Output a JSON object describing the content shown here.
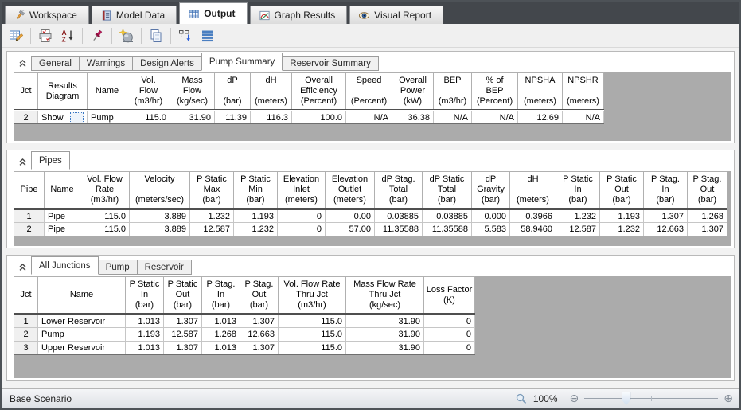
{
  "titlebar_tabs": {
    "items": [
      {
        "label": "Workspace",
        "icon": "workspace-icon"
      },
      {
        "label": "Model Data",
        "icon": "model-data-icon"
      },
      {
        "label": "Output",
        "icon": "output-icon",
        "active": true
      },
      {
        "label": "Graph Results",
        "icon": "graph-results-icon"
      },
      {
        "label": "Visual Report",
        "icon": "visual-report-icon"
      }
    ]
  },
  "toolbar": {
    "buttons": [
      "output-control",
      "print",
      "sort-az",
      "pin",
      "format-wizard",
      "copy",
      "transfer-results",
      "show-rows"
    ]
  },
  "sections": [
    {
      "id": "summary",
      "tabs": [
        "General",
        "Warnings",
        "Design Alerts",
        "Pump Summary",
        "Reservoir Summary"
      ],
      "active_tab": 3,
      "table": {
        "headers": [
          "Jct",
          "Results\nDiagram",
          "Name",
          "Vol.\nFlow\n(m3/hr)",
          "Mass\nFlow\n(kg/sec)",
          "dP\n\n(bar)",
          "dH\n\n(meters)",
          "Overall\nEfficiency\n(Percent)",
          "Speed\n\n(Percent)",
          "Overall\nPower\n(kW)",
          "BEP\n\n(m3/hr)",
          "% of\nBEP\n(Percent)",
          "NPSHA\n\n(meters)",
          "NPSHR\n\n(meters)"
        ],
        "aligns": [
          "center",
          "show",
          "left",
          "right",
          "right",
          "right",
          "right",
          "right",
          "right",
          "right",
          "right",
          "right",
          "right",
          "right"
        ],
        "rows": [
          [
            "2",
            {
              "label": "Show",
              "ellipsis": "..."
            },
            "Pump",
            "115.0",
            "31.90",
            "11.39",
            "116.3",
            "100.0",
            "N/A",
            "36.38",
            "N/A",
            "N/A",
            "12.69",
            "N/A"
          ]
        ]
      }
    },
    {
      "id": "pipes",
      "tabs": [
        "Pipes"
      ],
      "active_tab": 0,
      "table": {
        "headers": [
          "Pipe",
          "Name",
          "Vol. Flow\nRate\n(m3/hr)",
          "Velocity\n\n(meters/sec)",
          "P Static\nMax\n(bar)",
          "P Static\nMin\n(bar)",
          "Elevation\nInlet\n(meters)",
          "Elevation\nOutlet\n(meters)",
          "dP Stag.\nTotal\n(bar)",
          "dP Static\nTotal\n(bar)",
          "dP\nGravity\n(bar)",
          "dH\n\n(meters)",
          "P Static\nIn\n(bar)",
          "P Static\nOut\n(bar)",
          "P Stag.\nIn\n(bar)",
          "P Stag.\nOut\n(bar)"
        ],
        "aligns": [
          "center",
          "left",
          "right",
          "right",
          "right",
          "right",
          "right",
          "right",
          "right",
          "right",
          "right",
          "right",
          "right",
          "right",
          "right",
          "right"
        ],
        "rows": [
          [
            "1",
            "Pipe",
            "115.0",
            "3.889",
            "1.232",
            "1.193",
            "0",
            "0.00",
            "0.03885",
            "0.03885",
            "0.000",
            "0.3966",
            "1.232",
            "1.193",
            "1.307",
            "1.268"
          ],
          [
            "2",
            "Pipe",
            "115.0",
            "3.889",
            "12.587",
            "1.232",
            "0",
            "57.00",
            "11.35588",
            "11.35588",
            "5.583",
            "58.9460",
            "12.587",
            "1.232",
            "12.663",
            "1.307"
          ]
        ]
      }
    },
    {
      "id": "junctions",
      "tabs": [
        "All Junctions",
        "Pump",
        "Reservoir"
      ],
      "active_tab": 0,
      "table": {
        "headers": [
          "Jct",
          "Name",
          "P Static\nIn\n(bar)",
          "P Static\nOut\n(bar)",
          "P Stag.\nIn\n(bar)",
          "P Stag.\nOut\n(bar)",
          "Vol. Flow Rate\nThru Jct\n(m3/hr)",
          "Mass Flow Rate\nThru Jct\n(kg/sec)",
          "Loss Factor\n(K)"
        ],
        "aligns": [
          "center",
          "left",
          "right",
          "right",
          "right",
          "right",
          "right",
          "right",
          "right"
        ],
        "rows": [
          [
            "1",
            "Lower Reservoir",
            "1.013",
            "1.307",
            "1.013",
            "1.307",
            "115.0",
            "31.90",
            "0"
          ],
          [
            "2",
            "Pump",
            "1.193",
            "12.587",
            "1.268",
            "12.663",
            "115.0",
            "31.90",
            "0"
          ],
          [
            "3",
            "Upper Reservoir",
            "1.013",
            "1.307",
            "1.013",
            "1.307",
            "115.0",
            "31.90",
            "0"
          ]
        ]
      }
    }
  ],
  "statusbar": {
    "scenario_label": "Base Scenario",
    "zoom_percent": "100%"
  },
  "colors": {
    "tabbar_bg": "#43474c",
    "grid_empty_bg": "#ababab",
    "accent_blue": "#3c6eb4"
  }
}
